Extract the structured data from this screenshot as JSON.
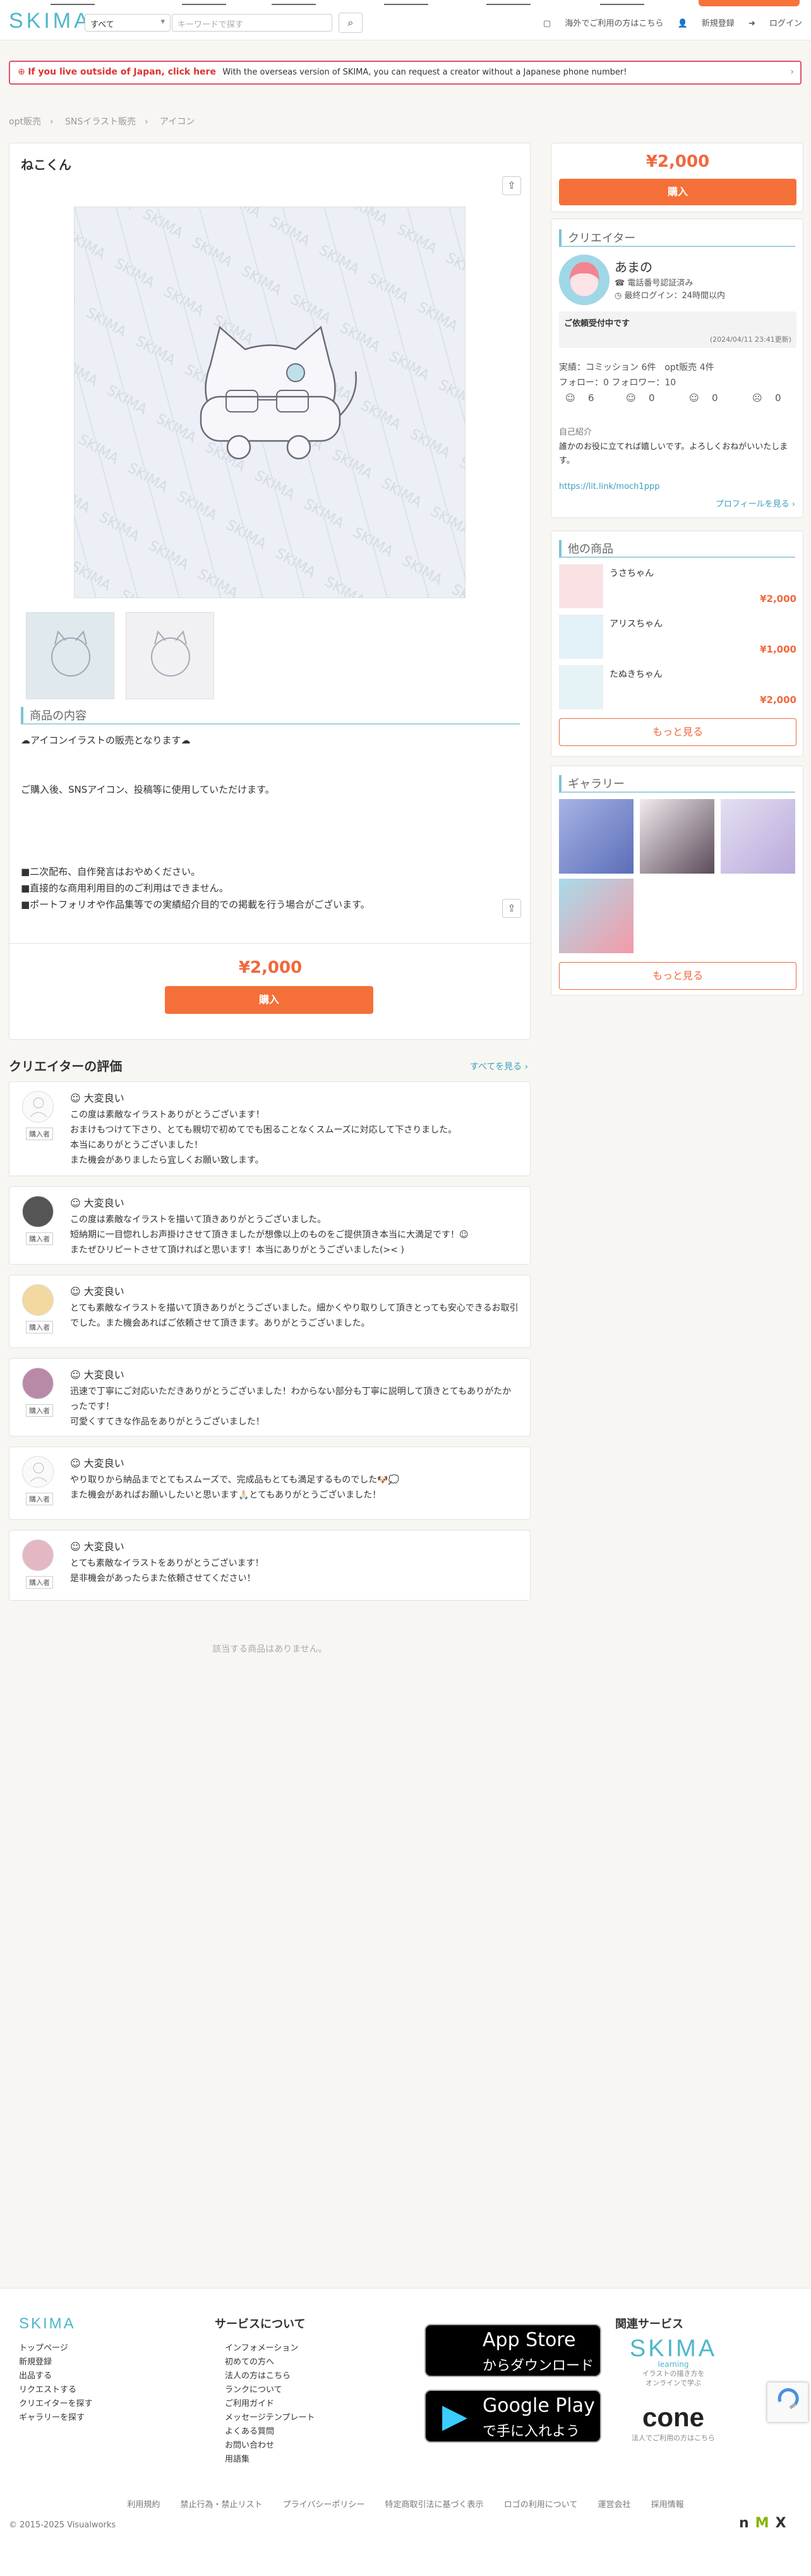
{
  "header": {
    "logo": "SKIMA",
    "category_select": "すべて",
    "search_placeholder": "キーワードで探す",
    "links": [
      "海外でご利用の方はこちら",
      "新規登録",
      "ログイン"
    ]
  },
  "banner": {
    "bold": "If you live outside of Japan, click here",
    "text": "With the overseas version of SKIMA, you can request a creator without a Japanese phone number!"
  },
  "breadcrumb": [
    "opt販売",
    "SNSイラスト販売",
    "アイコン"
  ],
  "product": {
    "title": "ねこくん",
    "section_title": "商品の内容",
    "description": "☁︎アイコンイラストの販売となります☁︎\n\n\nご購入後、SNSアイコン、投稿等に使用していただけます。\n\n\n\n\n■二次配布、自作発言はおやめください。\n■直接的な商用利用目的のご利用はできません。\n■ポートフォリオや作品集等での実績紹介目的での掲載を行う場合がございます。",
    "price": "¥2,000",
    "buy_label": "購入"
  },
  "sidebar": {
    "price": "¥2,000",
    "buy_label": "購入",
    "creator_title": "クリエイター",
    "creator_name": "あまの",
    "verified": "電話番号認証済み",
    "last_login": "最終ログイン：24時間以内",
    "status_label": "ご依頼受付中です",
    "status_date": "(2024/04/11 23:41更新)",
    "record_commission": "実績：コミッション 6件",
    "record_opt": "opt販売 4件",
    "follow": "フォロー：0 フォロワー：10",
    "rating_counts": [
      "6",
      "0",
      "0",
      "0"
    ],
    "intro_label": "自己紹介",
    "intro_text": "誰かのお役に立てれば嬉しいです。よろしくおねがいいたします。",
    "intro_link": "https://lit.link/moch1ppp",
    "profile_link": "プロフィールを見る ›",
    "other_title": "他の商品",
    "other_items": [
      {
        "name": "うさちゃん",
        "price": "¥2,000"
      },
      {
        "name": "アリスちゃん",
        "price": "¥1,000"
      },
      {
        "name": "たぬきちゃん",
        "price": "¥2,000"
      }
    ],
    "more_label": "もっと見る",
    "gallery_title": "ギャラリー",
    "gallery_more": "もっと見る"
  },
  "reviews": {
    "title": "クリエイターの評価",
    "see_all": "すべてを見る ›",
    "purchaser_tag": "購入者",
    "items": [
      {
        "rating": "大変良い",
        "text": "この度は素敵なイラストありがとうございます！\nおまけもつけて下さり、とても親切で初めてでも困ることなくスムーズに対応して下さりました。\n本当にありがとうございました！\nまた機会がありましたら宜しくお願い致します。"
      },
      {
        "rating": "大変良い",
        "text": "この度は素敵なイラストを描いて頂きありがとうございました。\n短納期に一目惚れしお声掛けさせて頂きましたが想像以上のものをご提供頂き本当に大満足です！☺︎\nまたぜひリピートさせて頂ければと思います！本当にありがとうございました(>< )"
      },
      {
        "rating": "大変良い",
        "text": "とても素敵なイラストを描いて頂きありがとうございました。細かくやり取りして頂きとっても安心できるお取引でした。また機会あればご依頼させて頂きます。ありがとうございました。"
      },
      {
        "rating": "大変良い",
        "text": "迅速で丁寧にご対応いただきありがとうございました！わからない部分も丁寧に説明して頂きとてもありがたかったです！\n可愛くすてきな作品をありがとうございました！"
      },
      {
        "rating": "大変良い",
        "text": "やり取りから納品までとてもスムーズで、完成品もとても満足するものでした🐶💭\nまた機会があればお願いしたいと思います🙏🏻とてもありがとうございました！"
      },
      {
        "rating": "大変良い",
        "text": "とても素敵なイラストをありがとうございます！\n是非機会があったらまた依頼させてください！"
      }
    ]
  },
  "related_empty": "該当する商品はありません。",
  "footer": {
    "logo": "SKIMA",
    "col1": [
      "トップページ",
      "新規登録",
      "出品する",
      "リクエストする",
      "クリエイターを探す",
      "ギャラリーを探す"
    ],
    "service_title": "サービスについて",
    "col2": [
      "インフォメーション",
      "初めての方へ",
      "法人の方はこちら",
      "ランクについて",
      "ご利用ガイド",
      "メッセージテンプレート",
      "よくある質問",
      "お問い合わせ",
      "用語集"
    ],
    "appstore_big": "App Store",
    "appstore_sub": "からダウンロード",
    "googleplay_big": "Google Play",
    "googleplay_sub": "で手に入れよう",
    "related_title": "関連サービス",
    "learning_logo": "SKIMA",
    "learning_sub": "learning",
    "learning_desc": "イラストの描き方を\nオンラインで学ぶ",
    "cone_logo": "cone",
    "cone_desc": "法人でご利用の方はこちら",
    "bottom_links": [
      "利用規約",
      "禁止行為・禁止リスト",
      "プライバシーポリシー",
      "特定商取引法に基づく表示",
      "ロゴの利用について",
      "運営会社",
      "採用情報"
    ],
    "copyright": "© 2015-2025 Visualworks"
  }
}
